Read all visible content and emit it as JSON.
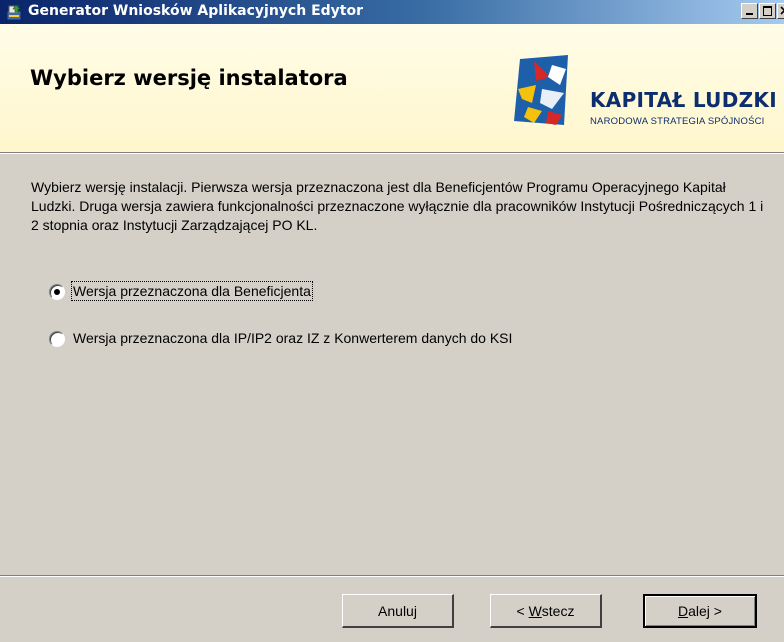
{
  "window": {
    "title": "Generator Wniosków Aplikacyjnych Edytor"
  },
  "header": {
    "title": "Wybierz wersję instalatora",
    "logo_name": "KAPITAŁ LUDZKI",
    "logo_subtitle": "NARODOWA STRATEGIA SPÓJNOŚCI"
  },
  "content": {
    "description": "Wybierz wersję instalacji. Pierwsza wersja przeznaczona jest dla Beneficjentów Programu Operacyjnego Kapitał Ludzki. Druga wersja zawiera funkcjonalności przeznaczone wyłącznie dla pracowników Instytucji Pośredniczących 1 i 2 stopnia oraz Instytucji Zarządzającej PO KL.",
    "options": [
      {
        "label": "Wersja przeznaczona dla Beneficjenta",
        "selected": true
      },
      {
        "label": "Wersja przeznaczona dla IP/IP2 oraz IZ z Konwerterem danych do KSI",
        "selected": false
      }
    ]
  },
  "buttons": {
    "cancel": "Anuluj",
    "back_prefix": "< ",
    "back_accel": "W",
    "back_rest": "stecz",
    "next_accel": "D",
    "next_rest": "alej >"
  },
  "colors": {
    "titlebar_start": "#0a246a",
    "titlebar_end": "#a6caf0",
    "header_bg": "#fff6cc",
    "face": "#d4d0c8",
    "logo_text": "#0c2e6e"
  },
  "icons": [
    "installer-app-icon",
    "minimize-icon",
    "maximize-icon",
    "close-icon",
    "kapital-ludzki-logo"
  ]
}
